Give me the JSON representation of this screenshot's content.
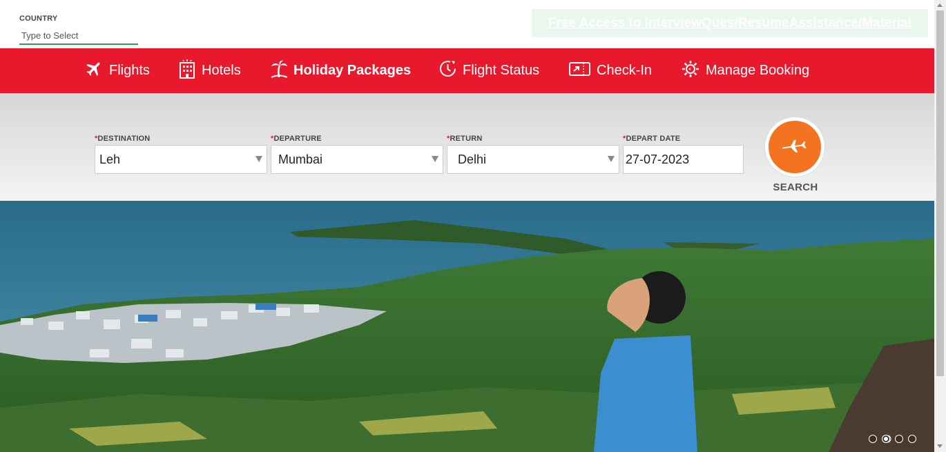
{
  "country": {
    "label": "COUNTRY",
    "placeholder": "Type to Select"
  },
  "promo": {
    "link_text": "Free Access to InterviewQues/ResumeAssistance/Material"
  },
  "nav": {
    "items": [
      {
        "label": "Flights",
        "icon": "plane-icon"
      },
      {
        "label": "Hotels",
        "icon": "hotel-building-icon"
      },
      {
        "label": "Holiday Packages",
        "icon": "palm-tree-icon"
      },
      {
        "label": "Flight Status",
        "icon": "clock-plane-icon"
      },
      {
        "label": "Check-In",
        "icon": "ticket-icon"
      },
      {
        "label": "Manage Booking",
        "icon": "gear-plane-icon"
      }
    ],
    "active": "Holiday Packages"
  },
  "search": {
    "destination": {
      "label": "DESTINATION",
      "value": "Leh"
    },
    "departure": {
      "label": "DEPARTURE",
      "value": "Mumbai"
    },
    "return": {
      "label": "RETURN",
      "value": "Delhi"
    },
    "depart_date": {
      "label": "DEPART DATE",
      "value": "27-07-2023"
    },
    "required_mark": "*",
    "button_label": "SEARCH"
  },
  "carousel": {
    "slide_count": 4,
    "active_index": 2
  },
  "colors": {
    "nav_red": "#e8192c",
    "search_orange": "#f47321",
    "field_underline": "#2e9e55"
  }
}
